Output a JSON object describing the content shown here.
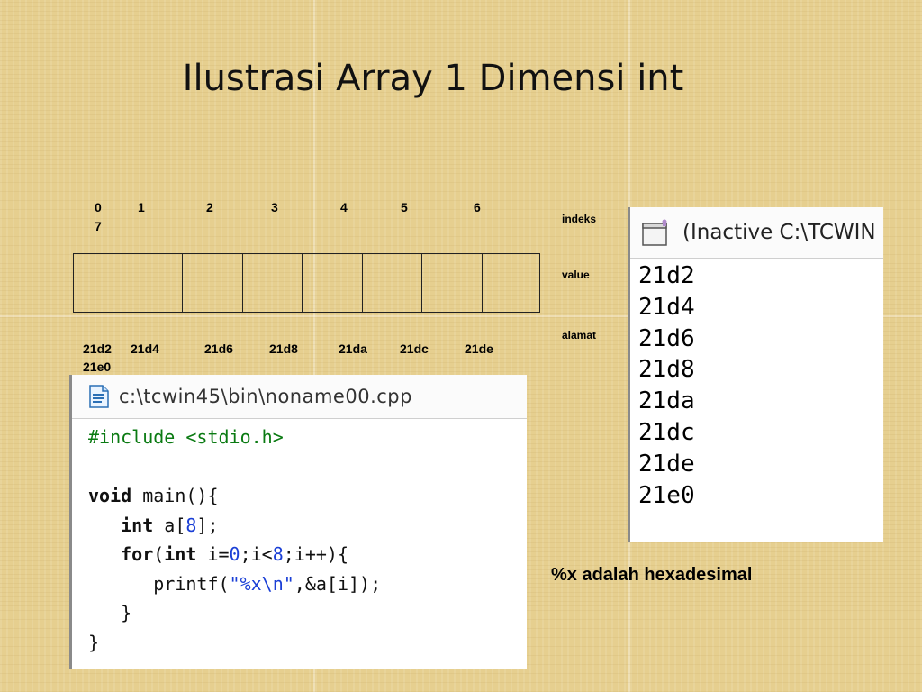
{
  "slide": {
    "title": "Ilustrasi Array 1 Dimensi int"
  },
  "array_diagram": {
    "indices": [
      "0",
      "1",
      "2",
      "3",
      "4",
      "5",
      "6",
      "7"
    ],
    "addresses": [
      "21d2",
      "21d4",
      "21d6",
      "21d8",
      "21da",
      "21dc",
      "21de",
      "21e0"
    ],
    "labels": {
      "indeks": "indeks",
      "value": "value",
      "alamat": "alamat"
    }
  },
  "code_window": {
    "title": "c:\\tcwin45\\bin\\noname00.cpp",
    "icon": "file-icon",
    "lines": {
      "l1_pp": "#include <stdio.h>",
      "l3_kw": "void",
      "l3_rest": " main(){",
      "l4_kw": "int",
      "l4_a": " a[",
      "l4_num": "8",
      "l4_b": "];",
      "l5_kw1": "for",
      "l5_p": "(",
      "l5_kw2": "int",
      "l5_a": " i=",
      "l5_num1": "0",
      "l5_b": ";i<",
      "l5_num2": "8",
      "l5_c": ";i++){",
      "l6_a": "printf(",
      "l6_str": "\"%x\\n\"",
      "l6_b": ",&a[i]);",
      "l7": "}",
      "l8": "}"
    }
  },
  "console_window": {
    "title": "(Inactive C:\\TCWIN",
    "icon": "console-window-icon",
    "output": [
      "21d2",
      "21d4",
      "21d6",
      "21d8",
      "21da",
      "21dc",
      "21de",
      "21e0"
    ]
  },
  "note": "%x adalah hexadesimal",
  "colors": {
    "background": "#e6cf8f",
    "preprocessor": "#0a7a12",
    "literal": "#1a3fd6"
  }
}
